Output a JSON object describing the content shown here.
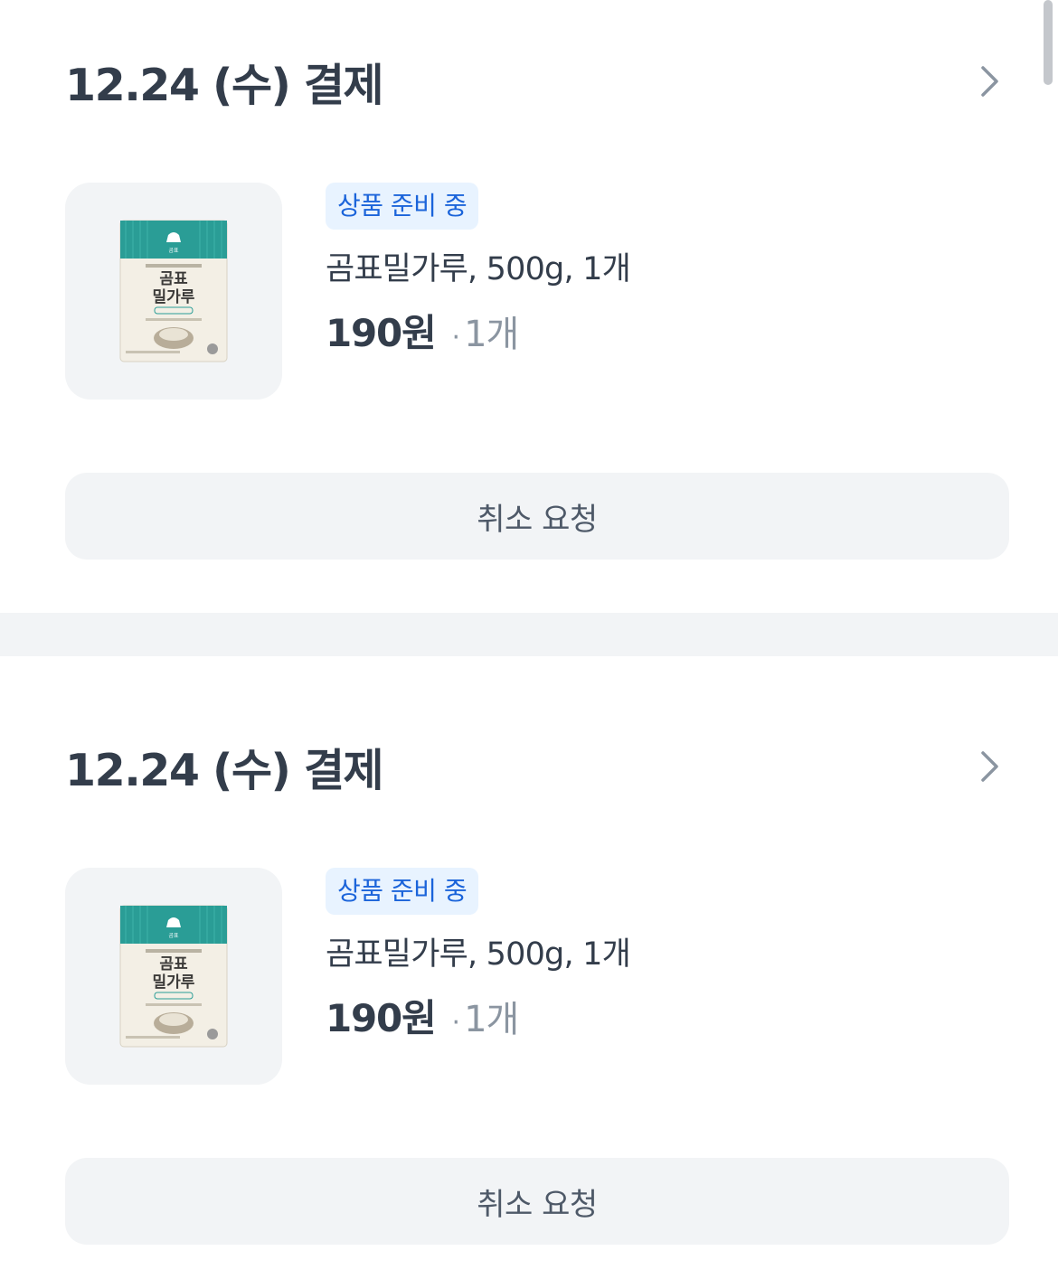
{
  "orders": [
    {
      "title": "12.24 (수) 결제",
      "status": "상품 준비 중",
      "product_name": "곰표밀가루, 500g, 1개",
      "price": "190원",
      "qty_sep": "·",
      "qty": "1개",
      "cancel_label": "취소 요청",
      "thumb_brand": "곰표",
      "thumb_name_line1": "곰표",
      "thumb_name_line2": "밀가루"
    },
    {
      "title": "12.24 (수) 결제",
      "status": "상품 준비 중",
      "product_name": "곰표밀가루, 500g, 1개",
      "price": "190원",
      "qty_sep": "·",
      "qty": "1개",
      "cancel_label": "취소 요청",
      "thumb_brand": "곰표",
      "thumb_name_line1": "곰표",
      "thumb_name_line2": "밀가루"
    }
  ],
  "colors": {
    "badge_bg": "#e8f3ff",
    "badge_text": "#1b64da",
    "title": "#333d4b",
    "muted": "#8b95a1",
    "button_bg": "#f2f4f6",
    "package_teal": "#2a9d96"
  },
  "icons": {
    "chevron": "chevron-right-icon"
  }
}
